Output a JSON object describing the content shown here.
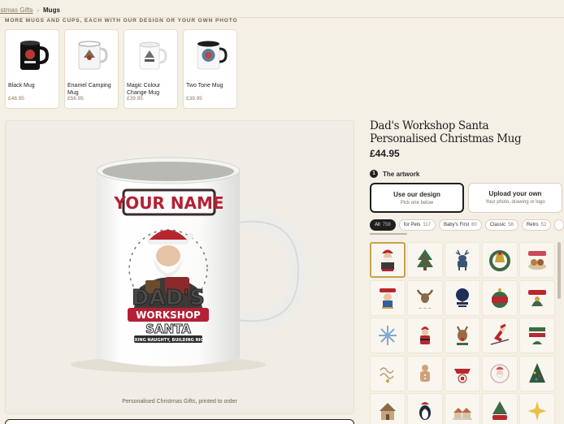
{
  "breadcrumb": {
    "parent": "Christmas Gifts",
    "current": "Mugs"
  },
  "section_title": "MORE MUGS AND CUPS, EACH WITH OUR DESIGN OR YOUR OWN PHOTO",
  "variants": [
    {
      "name": "Black Mug",
      "price": "£48.95",
      "icon": "black-mug-icon"
    },
    {
      "name": "Enamel Camping Mug",
      "price": "£56.95",
      "icon": "enamel-camping-mug-icon"
    },
    {
      "name": "Magic Colour Change Mug",
      "price": "£39.95",
      "icon": "magic-colour-mug-icon"
    },
    {
      "name": "Two Tone Mug",
      "price": "£39.95",
      "icon": "two-tone-mug-icon"
    }
  ],
  "preview": {
    "name_label": "YOUR NAME",
    "art_line1": "DAD'S",
    "art_line2": "WORKSHOP",
    "art_line3": "SANTA",
    "art_banner": "FIXING NAUGHTY, BUILDING NICE",
    "caption": "Personalised Christmas Gifts, printed to order"
  },
  "product": {
    "title": "Dad's Workshop Santa Personalised Christmas Mug",
    "price": "£44.95"
  },
  "artwork_step": {
    "number": "1",
    "label": "The artwork"
  },
  "options": [
    {
      "title": "Use our design",
      "subtitle": "Pick one below"
    },
    {
      "title": "Upload your own",
      "subtitle": "Your photo, drawing or logo"
    }
  ],
  "filters": [
    {
      "label": "All",
      "count": "758"
    },
    {
      "label": "for Pets",
      "count": "117"
    },
    {
      "label": "Baby's First",
      "count": "60"
    },
    {
      "label": "Classic",
      "count": "58"
    },
    {
      "label": "Retro",
      "count": "52"
    }
  ],
  "designs": [
    "santa-workshop-icon",
    "christmas-tree-icon",
    "reindeer-icon",
    "bell-wreath-icon",
    "cookies-icon",
    "australia-santa-icon",
    "moose-icon",
    "tree-sign-icon",
    "christmas-ornament-icon",
    "aussie-christmas-icon",
    "snowflake-icon",
    "santa-figure-icon",
    "reindeer-christmas-icon",
    "santa-skiing-icon",
    "merry-christmas-icon",
    "merry-christmas-script-icon",
    "gingerbread-sign-icon",
    "howzat-cricket-icon",
    "santa-portrait-icon",
    "christmas-tree-lights-icon",
    "gingerbread-house-icon",
    "penguin-icon",
    "snowy-village-icon",
    "aussie-tree-icon",
    "star-icon"
  ],
  "colors": {
    "accent": "#c6a24e",
    "dark": "#1f1f1f",
    "background": "#f5f0e6",
    "muted": "#8a7a62"
  }
}
